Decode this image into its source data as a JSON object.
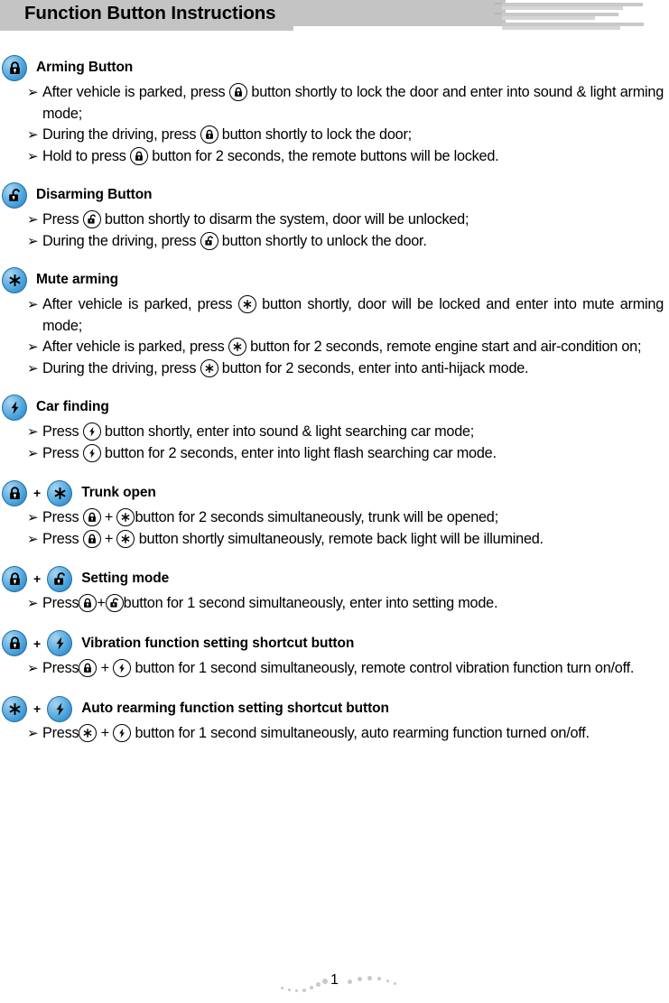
{
  "header": {
    "title": "Function Button Instructions",
    "bar_color": "#c4c4c4"
  },
  "icons": {
    "lock": "lock-closed-icon",
    "unlock": "lock-open-icon",
    "star": "asterisk-icon",
    "bolt": "lightning-bolt-icon"
  },
  "accent_color": "#3f9ad6",
  "sections": [
    {
      "id": "arming-button",
      "title": "Arming Button",
      "head_icons": [
        "lock"
      ],
      "bullets": [
        {
          "parts": [
            {
              "t": "text",
              "v": "After vehicle is  parked,  press "
            },
            {
              "t": "icon",
              "v": "lock"
            },
            {
              "t": "text",
              "v": "  button shortly  to lock  the door  and enter into sound & light arming mode;"
            }
          ]
        },
        {
          "parts": [
            {
              "t": "text",
              "v": "During the driving, press "
            },
            {
              "t": "icon",
              "v": "lock"
            },
            {
              "t": "text",
              "v": " button shortly to lock the door;"
            }
          ]
        },
        {
          "parts": [
            {
              "t": "text",
              "v": "Hold to press "
            },
            {
              "t": "icon",
              "v": "lock"
            },
            {
              "t": "text",
              "v": " button for 2 seconds, the remote buttons will  be locked."
            }
          ]
        }
      ]
    },
    {
      "id": "disarming-button",
      "title": "Disarming Button",
      "head_icons": [
        "unlock"
      ],
      "bullets": [
        {
          "parts": [
            {
              "t": "text",
              "v": "Press  "
            },
            {
              "t": "icon",
              "v": "unlock"
            },
            {
              "t": "text",
              "v": "  button shortly to disarm the system, door will be unlocked;"
            }
          ]
        },
        {
          "parts": [
            {
              "t": "text",
              "v": "During the driving,  press  "
            },
            {
              "t": "icon",
              "v": "unlock"
            },
            {
              "t": "text",
              "v": "  button shortly to unlock the door."
            }
          ]
        }
      ]
    },
    {
      "id": "mute-arming",
      "title": "Mute arming",
      "head_icons": [
        "star"
      ],
      "bullets": [
        {
          "parts": [
            {
              "t": "text",
              "v": "After  vehicle is  parked,  press  "
            },
            {
              "t": "icon",
              "v": "star"
            },
            {
              "t": "text",
              "v": "   button shortly,  door  will  be  locked and enter into mute arming mode;"
            }
          ]
        },
        {
          "parts": [
            {
              "t": "text",
              "v": "After vehicle is parked, press  "
            },
            {
              "t": "icon",
              "v": "star"
            },
            {
              "t": "text",
              "v": "  button for 2 seconds, remote engine start and air-condition on;"
            }
          ]
        },
        {
          "parts": [
            {
              "t": "text",
              "v": "During  the  driving,  press  "
            },
            {
              "t": "icon",
              "v": "star"
            },
            {
              "t": "text",
              "v": "   button  for 2  seconds,  enter into  anti-hijack mode."
            }
          ]
        }
      ]
    },
    {
      "id": "car-finding",
      "title": "Car finding",
      "head_icons": [
        "bolt"
      ],
      "bullets": [
        {
          "parts": [
            {
              "t": "text",
              "v": "Press "
            },
            {
              "t": "icon",
              "v": "bolt"
            },
            {
              "t": "text",
              "v": "  button shortly, enter into sound & light searching car mode;"
            }
          ]
        },
        {
          "parts": [
            {
              "t": "text",
              "v": "Press "
            },
            {
              "t": "icon",
              "v": "bolt"
            },
            {
              "t": "text",
              "v": " button for 2 seconds, enter into light flash searching car mode."
            }
          ]
        }
      ]
    },
    {
      "id": "trunk-open",
      "title": "Trunk open",
      "head_icons": [
        "lock",
        "star"
      ],
      "head_plus": "+",
      "bullets": [
        {
          "parts": [
            {
              "t": "text",
              "v": "Press "
            },
            {
              "t": "icon",
              "v": "lock"
            },
            {
              "t": "text",
              "v": " + "
            },
            {
              "t": "icon",
              "v": "star"
            },
            {
              "t": "text",
              "v": "button for 2 seconds simultaneously, trunk will be opened;"
            }
          ]
        },
        {
          "parts": [
            {
              "t": "text",
              "v": "Press  "
            },
            {
              "t": "icon",
              "v": "lock"
            },
            {
              "t": "text",
              "v": "  +  "
            },
            {
              "t": "icon",
              "v": "star"
            },
            {
              "t": "text",
              "v": "   button  shortly  simultaneously,  remote  back  light  will  be illumined."
            }
          ]
        }
      ]
    },
    {
      "id": "setting-mode",
      "title": "Setting mode",
      "head_icons": [
        "lock",
        "unlock"
      ],
      "head_plus": "+",
      "bullets": [
        {
          "parts": [
            {
              "t": "text",
              "v": "Press"
            },
            {
              "t": "icon",
              "v": "lock"
            },
            {
              "t": "text",
              "v": "+"
            },
            {
              "t": "icon",
              "v": "unlock"
            },
            {
              "t": "text",
              "v": "button for 1 second simultaneously, enter into setting mode."
            }
          ]
        }
      ]
    },
    {
      "id": "vibration-shortcut",
      "title": "Vibration function setting shortcut button",
      "head_icons": [
        "lock",
        "bolt"
      ],
      "head_plus": "+",
      "bullets": [
        {
          "parts": [
            {
              "t": "text",
              "v": "Press"
            },
            {
              "t": "icon",
              "v": "lock"
            },
            {
              "t": "text",
              "v": " + "
            },
            {
              "t": "icon",
              "v": "bolt"
            },
            {
              "t": "text",
              "v": " button  for 1  second simultaneously, remote  control vibration function turn on/off."
            }
          ]
        }
      ]
    },
    {
      "id": "auto-rearming-shortcut",
      "title": "Auto rearming function setting shortcut button",
      "head_icons": [
        "star",
        "bolt"
      ],
      "head_plus": "+",
      "bullets": [
        {
          "parts": [
            {
              "t": "text",
              "v": "Press"
            },
            {
              "t": "icon",
              "v": "star"
            },
            {
              "t": "text",
              "v": " + "
            },
            {
              "t": "icon",
              "v": "bolt"
            },
            {
              "t": "text",
              "v": "  button  for 1  second simultaneously,  auto  rearming function turned on/off."
            }
          ]
        }
      ]
    }
  ],
  "bullet_marker": "➢",
  "footer": {
    "page_number": "1"
  }
}
